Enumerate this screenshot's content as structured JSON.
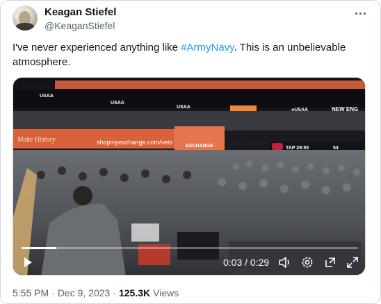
{
  "author": {
    "display_name": "Keagan Stiefel",
    "handle": "@KeaganStiefel"
  },
  "more_menu": {
    "icon": "more-horizontal-icon"
  },
  "tweet": {
    "text_before": "I've never experienced anything like ",
    "hashtag": "#ArmyNavy",
    "text_after": ". This is an unbelievable atmosphere."
  },
  "video": {
    "time_current": "0:03",
    "time_sep": " / ",
    "time_total": "0:29",
    "progress_fraction": 0.103,
    "scene_signs": {
      "sponsor": "USAA",
      "sponsor_right": "●USAA",
      "exchange": "EXCHANGE",
      "exchange_url": "shopmyexchange.com/vets",
      "exchange_tag": "Make History",
      "new_eng": "NEW ENG",
      "score_left": "TAP 29:55",
      "score_mid": "54"
    },
    "controls": {
      "play_icon": "play-icon",
      "volume_icon": "volume-icon",
      "settings_icon": "settings-icon",
      "popout_icon": "popout-icon",
      "fullscreen_icon": "fullscreen-icon"
    }
  },
  "meta": {
    "time": "5:55 PM",
    "separator": "·",
    "date": "Dec 9, 2023",
    "views_count": "125.3K",
    "views_label": "Views"
  }
}
